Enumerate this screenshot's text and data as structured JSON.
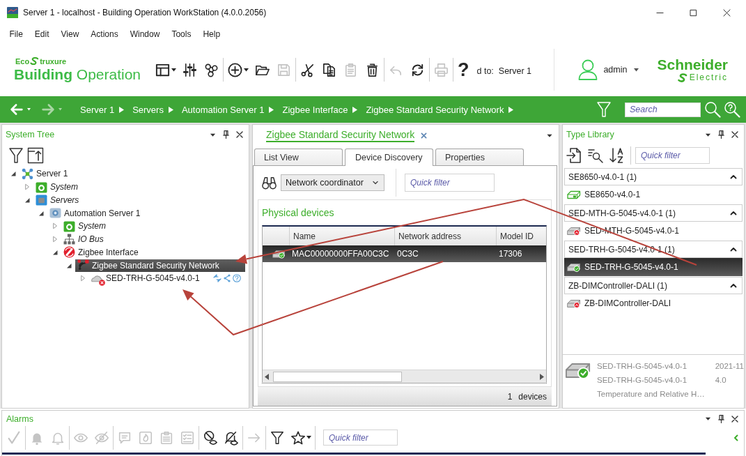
{
  "window": {
    "title": "Server 1 - localhost - Building Operation WorkStation (4.0.0.2056)"
  },
  "menu": [
    "File",
    "Edit",
    "View",
    "Actions",
    "Window",
    "Tools",
    "Help"
  ],
  "brand": {
    "eco": "Eco",
    "truxure": "truxure",
    "product": "**Building** Operation"
  },
  "toolbar": {
    "groups": [
      {
        "items": [
          {
            "kind": "layout",
            "disabled": false,
            "dropdown": true
          },
          {
            "kind": "sliders",
            "disabled": false
          },
          {
            "kind": "bindings",
            "disabled": false
          }
        ]
      },
      {
        "items": [
          {
            "kind": "add",
            "disabled": false,
            "dropdown": true
          },
          {
            "kind": "open",
            "disabled": false
          },
          {
            "kind": "save",
            "disabled": true
          }
        ]
      },
      {
        "items": [
          {
            "kind": "cut",
            "disabled": false
          },
          {
            "kind": "copy",
            "disabled": false
          },
          {
            "kind": "paste",
            "disabled": true
          },
          {
            "kind": "delete",
            "disabled": false
          }
        ]
      },
      {
        "items": [
          {
            "kind": "undo",
            "disabled": true
          },
          {
            "kind": "refresh",
            "disabled": false
          }
        ]
      },
      {
        "items": [
          {
            "kind": "print",
            "disabled": true
          }
        ]
      },
      {
        "items": [
          {
            "kind": "help",
            "label": "?",
            "disabled": false
          }
        ]
      }
    ],
    "connection": {
      "label": "d to:",
      "value": "Server 1"
    }
  },
  "user": {
    "name": "admin"
  },
  "company": {
    "name": "Schneider",
    "tagline": "Electric"
  },
  "nav": {
    "history": [
      {
        "kind": "back",
        "disabled": false
      },
      {
        "kind": "forward",
        "disabled": true
      }
    ],
    "breadcrumb": [
      "Server 1",
      "Servers",
      "Automation Server 1",
      "Zigbee Interface",
      "Zigbee Standard Security Network"
    ],
    "search": {
      "placeholder": "Search"
    }
  },
  "system_tree": {
    "title": "System Tree",
    "items": [
      {
        "label": "Server 1",
        "kind": "server",
        "expanded": true,
        "selected": false,
        "children": [
          {
            "label": "System",
            "kind": "system",
            "expanded": false,
            "selected": false
          },
          {
            "label": "Servers",
            "kind": "servers",
            "expanded": true,
            "selected": false,
            "children": [
              {
                "label": "Automation Server 1",
                "kind": "automation-server",
                "expanded": true,
                "selected": false,
                "children": [
                  {
                    "label": "System",
                    "kind": "system",
                    "expanded": false,
                    "selected": false
                  },
                  {
                    "label": "IO Bus",
                    "kind": "io-bus",
                    "expanded": false,
                    "selected": false
                  },
                  {
                    "label": "Zigbee Interface",
                    "kind": "zigbee-interface",
                    "expanded": true,
                    "selected": false,
                    "children": [
                      {
                        "label": "Zigbee Standard Security Network",
                        "kind": "zigbee-network",
                        "expanded": true,
                        "selected": true,
                        "children": [
                          {
                            "label": "SED-TRH-G-5045-v4.0-1",
                            "kind": "device",
                            "expanded": false,
                            "selected": false,
                            "error": true
                          }
                        ]
                      }
                    ]
                  }
                ]
              }
            ]
          }
        ]
      }
    ]
  },
  "document": {
    "title": "Zigbee Standard Security Network",
    "tabs": [
      {
        "label": "List View",
        "selected": false
      },
      {
        "label": "Device Discovery",
        "selected": true
      },
      {
        "label": "Properties",
        "selected": false
      }
    ],
    "dropdown": {
      "value": "Network coordinator"
    },
    "filter": {
      "placeholder": "Quick filter"
    },
    "section_title": "Physical devices",
    "table": {
      "columns": [
        "Name",
        "Network address",
        "Model ID"
      ],
      "rows": [
        {
          "kind": "ok",
          "cells": [
            "MAC00000000FFA00C3C",
            "0C3C",
            "17306"
          ],
          "selected": true
        }
      ]
    },
    "footer": {
      "count": "1",
      "label": "devices"
    }
  },
  "type_library": {
    "title": "Type Library",
    "filter": {
      "placeholder": "Quick filter"
    },
    "groups": [
      {
        "title": "SE8650-v4.0-1 (1)",
        "expanded": true,
        "items": [
          {
            "label": "SE8650-v4.0-1",
            "kind": "outline",
            "selected": false
          }
        ]
      },
      {
        "title": "SED-MTH-G-5045-v4.0-1 (1)",
        "expanded": true,
        "items": [
          {
            "label": "SED-MTH-G-5045-v4.0-1",
            "kind": "alert",
            "selected": false
          }
        ]
      },
      {
        "title": "SED-TRH-G-5045-v4.0-1 (1)",
        "expanded": true,
        "items": [
          {
            "label": "SED-TRH-G-5045-v4.0-1",
            "kind": "ok",
            "selected": true
          }
        ]
      },
      {
        "title": "ZB-DIMController-DALI (1)",
        "expanded": true,
        "items": [
          {
            "label": "ZB-DIMController-DALI",
            "kind": "alert",
            "selected": false
          }
        ]
      }
    ],
    "details": {
      "kind": "ok",
      "lines": [
        [
          "SED-TRH-G-5045-v4.0-1",
          "2021-11"
        ],
        [
          "SED-TRH-G-5045-v4.0-1",
          "4.0"
        ],
        [
          "Temperature and Relative H…"
        ]
      ]
    }
  },
  "alarms": {
    "title": "Alarms",
    "toolbar": {
      "groups": [
        {
          "items": [
            {
              "kind": "acknowledge",
              "disabled": true
            }
          ]
        },
        {
          "items": [
            {
              "kind": "bell-check",
              "disabled": true
            },
            {
              "kind": "bell",
              "disabled": true
            }
          ]
        },
        {
          "items": [
            {
              "kind": "eye",
              "disabled": true
            },
            {
              "kind": "eye-slash",
              "disabled": true
            }
          ]
        },
        {
          "items": [
            {
              "kind": "comment",
              "disabled": true
            },
            {
              "kind": "flame",
              "disabled": true
            },
            {
              "kind": "notes",
              "disabled": true
            },
            {
              "kind": "checklist",
              "disabled": true
            }
          ]
        },
        {
          "items": [
            {
              "kind": "hide",
              "disabled": false
            },
            {
              "kind": "bell-slash",
              "disabled": false
            }
          ]
        },
        {
          "items": [
            {
              "kind": "forward",
              "disabled": true
            }
          ]
        },
        {
          "items": [
            {
              "kind": "filter",
              "disabled": false
            },
            {
              "kind": "star",
              "disabled": false,
              "dropdown": true
            }
          ]
        }
      ]
    },
    "filter": {
      "placeholder": "Quick filter"
    }
  }
}
